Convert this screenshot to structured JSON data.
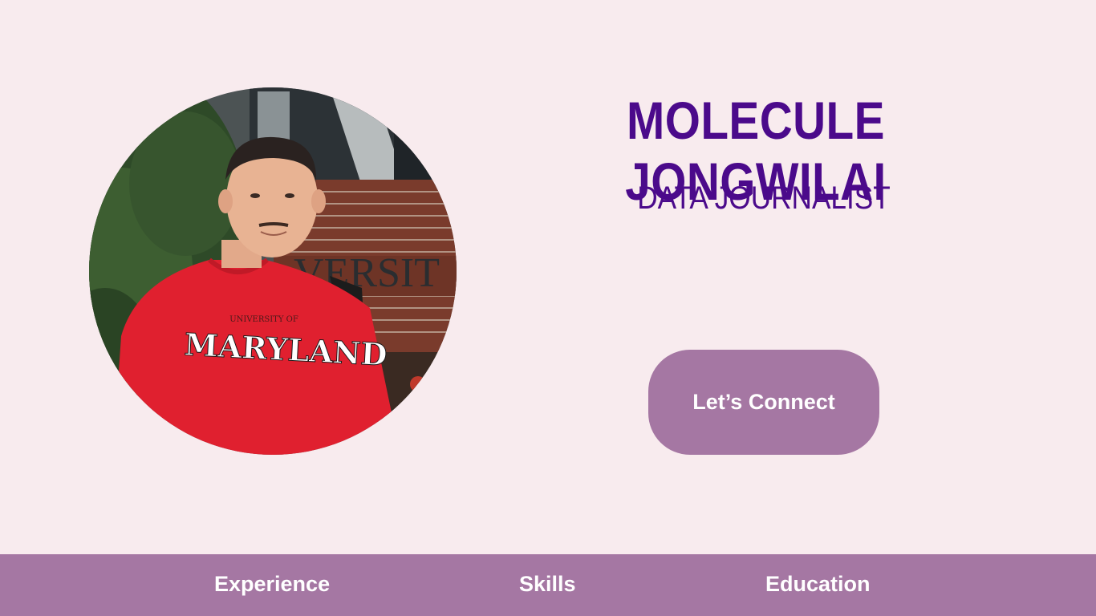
{
  "profile": {
    "name": "MOLECULE JONGWILAI",
    "role": "DATA JOURNALIST",
    "photo_alt": "Portrait photo",
    "shirt_text": "MARYLAND",
    "shirt_small_text": "UNIVERSITY OF",
    "sign_text": "VERSIT"
  },
  "cta": {
    "label": "Let’s Connect"
  },
  "nav": {
    "items": [
      {
        "label": "Experience"
      },
      {
        "label": "Skills"
      },
      {
        "label": "Education"
      }
    ]
  },
  "colors": {
    "background": "#f8ebee",
    "accent": "#a577a3",
    "heading": "#4b0a8b",
    "button_text": "#ffffff"
  }
}
